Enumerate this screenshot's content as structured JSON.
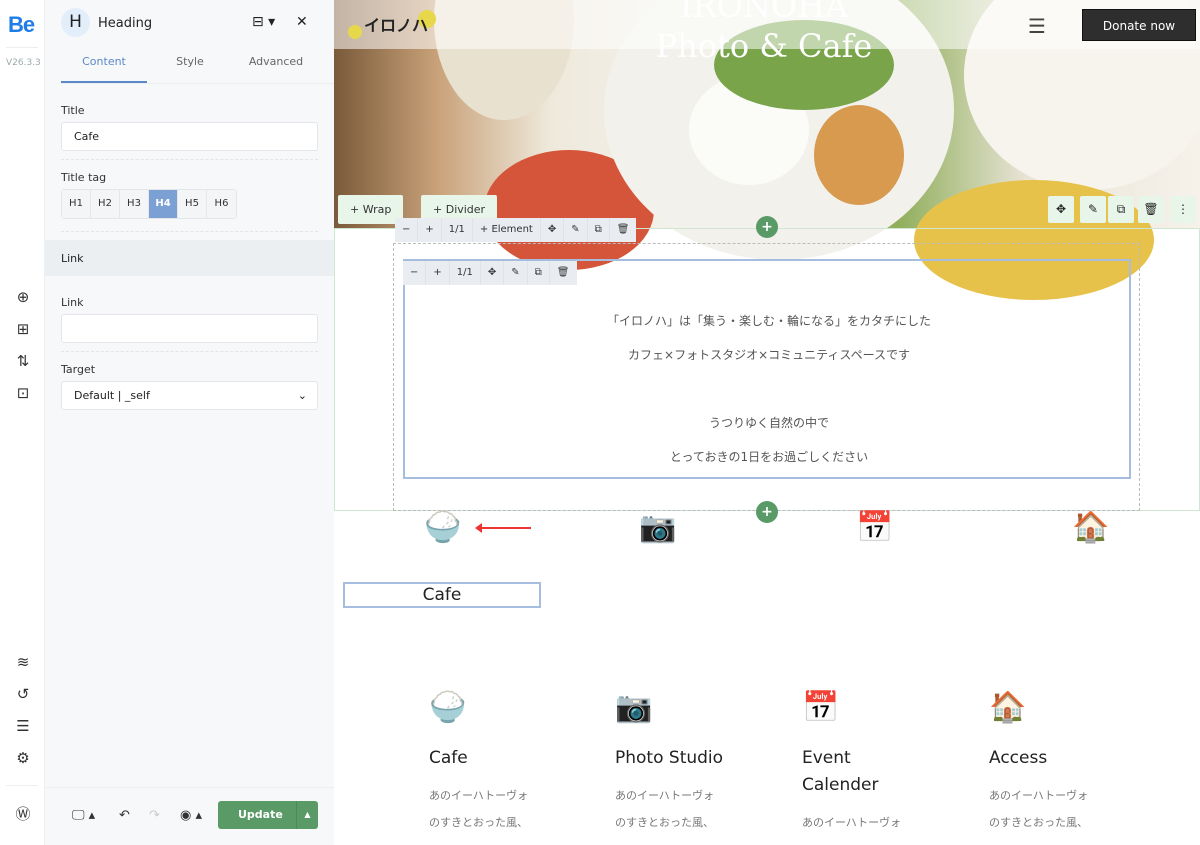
{
  "rail": {
    "logo": "Be",
    "version": "V26.3.3"
  },
  "panel": {
    "element_icon": "H",
    "title": "Heading",
    "tabs": [
      {
        "label": "Content",
        "active": true
      },
      {
        "label": "Style"
      },
      {
        "label": "Advanced"
      }
    ],
    "title_label": "Title",
    "title_value": "Cafe",
    "title_tag_label": "Title tag",
    "tags": [
      "H1",
      "H2",
      "H3",
      "H4",
      "H5",
      "H6"
    ],
    "selected_tag": "H4",
    "link_section": "Link",
    "link_label": "Link",
    "link_value": "",
    "target_label": "Target",
    "target_value": "Default | _self",
    "update_label": "Update"
  },
  "canvas": {
    "brand": "イロノハ",
    "hero_title_1": "IRONOHA",
    "hero_title_2": "Photo & Cafe",
    "donate": "Donate now",
    "wrap_btn": "Wrap",
    "divider_btn": "Divider",
    "element_btn": "Element",
    "ratio": "1/1",
    "lines": [
      "「イロノハ」は「集う・楽しむ・輪になる」をカタチにした",
      "カフェ×フォトスタジオ×コミュニティスペースです",
      "うつりゆく自然の中で",
      "とっておきの1日をお過ごしください"
    ],
    "selected_heading": "Cafe",
    "features": [
      {
        "title": "Cafe",
        "icon": "bowl-icon",
        "lines": [
          "あのイーハトーヴォ",
          "のすきとおった風、"
        ]
      },
      {
        "title": "Photo Studio",
        "icon": "camera-icon",
        "lines": [
          "あのイーハトーヴォ",
          "のすきとおった風、"
        ]
      },
      {
        "title": "Event Calender",
        "icon": "calendar-icon",
        "lines": [
          "あのイーハトーヴォ"
        ]
      },
      {
        "title": "Access",
        "icon": "house-icon",
        "lines": [
          "あのイーハトーヴォ",
          "のすきとおった風、"
        ]
      }
    ]
  },
  "colors": {
    "accent": "#5a9a67",
    "selection": "#7ba1d4",
    "brand": "#1e7de6"
  }
}
